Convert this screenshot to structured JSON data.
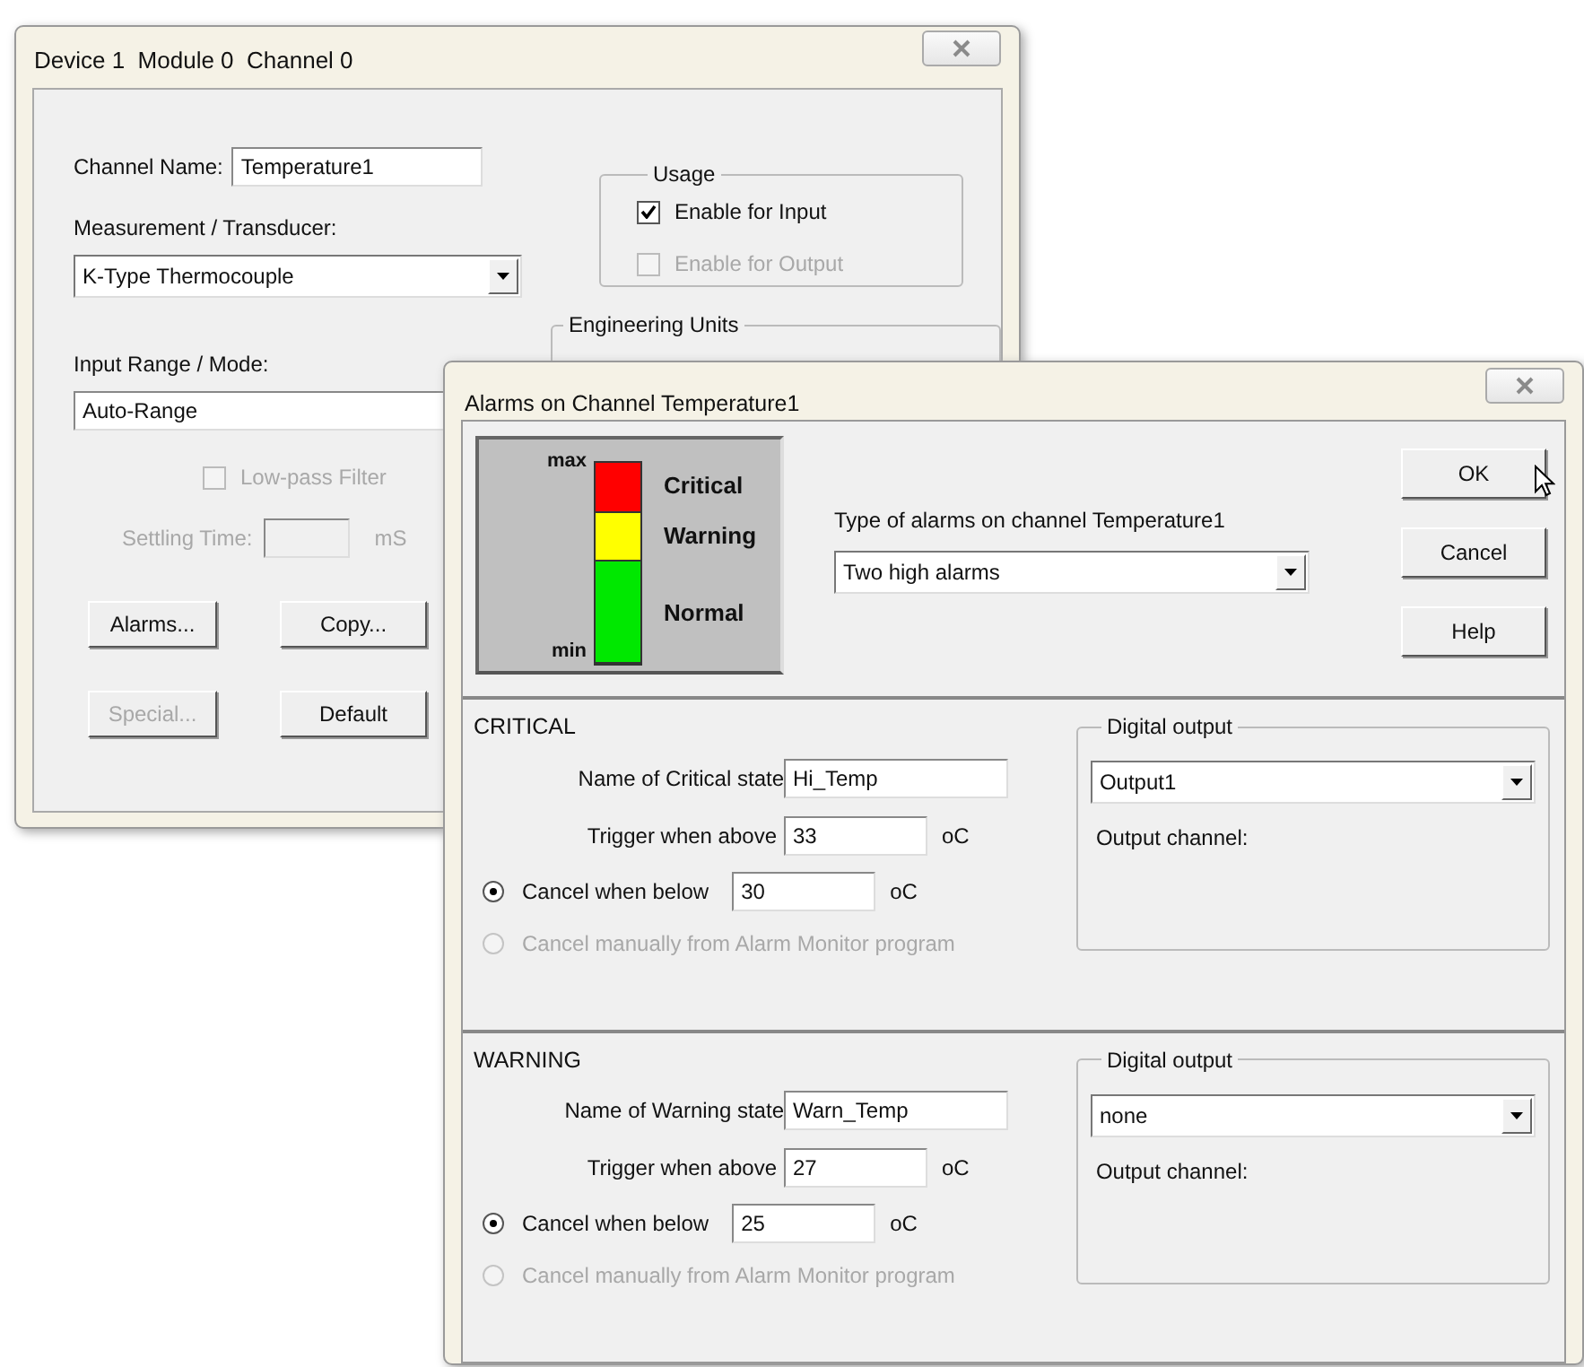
{
  "device_window": {
    "title": "Device 1  Module 0  Channel 0",
    "channel_name": {
      "label": "Channel Name:",
      "value": "Temperature1"
    },
    "measurement": {
      "label": "Measurement / Transducer:",
      "value": "K-Type Thermocouple"
    },
    "input_range": {
      "label": "Input Range / Mode:",
      "value": "Auto-Range"
    },
    "low_pass": {
      "label": "Low-pass Filter",
      "checked": false,
      "disabled": true
    },
    "settling": {
      "label": "Settling Time:",
      "unit": "mS",
      "disabled": true
    },
    "usage": {
      "title": "Usage",
      "options": [
        {
          "label": "Enable for Input",
          "checked": true,
          "disabled": false
        },
        {
          "label": "Enable for Output",
          "checked": false,
          "disabled": true
        }
      ]
    },
    "engineering_units": {
      "title": "Engineering Units"
    },
    "buttons": [
      {
        "label": "Alarms...",
        "disabled": false
      },
      {
        "label": "Copy...",
        "disabled": false
      },
      {
        "label": "Special...",
        "disabled": true
      },
      {
        "label": "Default",
        "disabled": false
      }
    ]
  },
  "alarm_window": {
    "title": "Alarms on Channel Temperature1",
    "legend": {
      "max": "max",
      "min": "min",
      "levels": [
        {
          "label": "Critical",
          "color": "#ff0000"
        },
        {
          "label": "Warning",
          "color": "#ffff00"
        },
        {
          "label": "Normal",
          "color": "#00e800"
        }
      ]
    },
    "type_label": "Type of alarms on channel Temperature1",
    "type_value": "Two high alarms",
    "buttons": [
      "OK",
      "Cancel",
      "Help"
    ],
    "sections": [
      {
        "heading": "CRITICAL",
        "name_label": "Name of Critical state",
        "name_value": "Hi_Temp",
        "trigger_label": "Trigger when above",
        "trigger_value": "33",
        "trigger_unit": "oC",
        "cancel_below": {
          "label": "Cancel when below",
          "value": "30",
          "unit": "oC",
          "selected": true
        },
        "cancel_manual": {
          "label": "Cancel manually from Alarm Monitor program",
          "selected": false,
          "disabled": true
        },
        "digital_output": {
          "title": "Digital output",
          "value": "Output1",
          "channel_label": "Output channel:"
        }
      },
      {
        "heading": "WARNING",
        "name_label": "Name of Warning state",
        "name_value": "Warn_Temp",
        "trigger_label": "Trigger when above",
        "trigger_value": "27",
        "trigger_unit": "oC",
        "cancel_below": {
          "label": "Cancel when below",
          "value": "25",
          "unit": "oC",
          "selected": true
        },
        "cancel_manual": {
          "label": "Cancel manually from Alarm Monitor program",
          "selected": false,
          "disabled": true
        },
        "digital_output": {
          "title": "Digital output",
          "value": "none",
          "channel_label": "Output channel:"
        }
      }
    ]
  }
}
